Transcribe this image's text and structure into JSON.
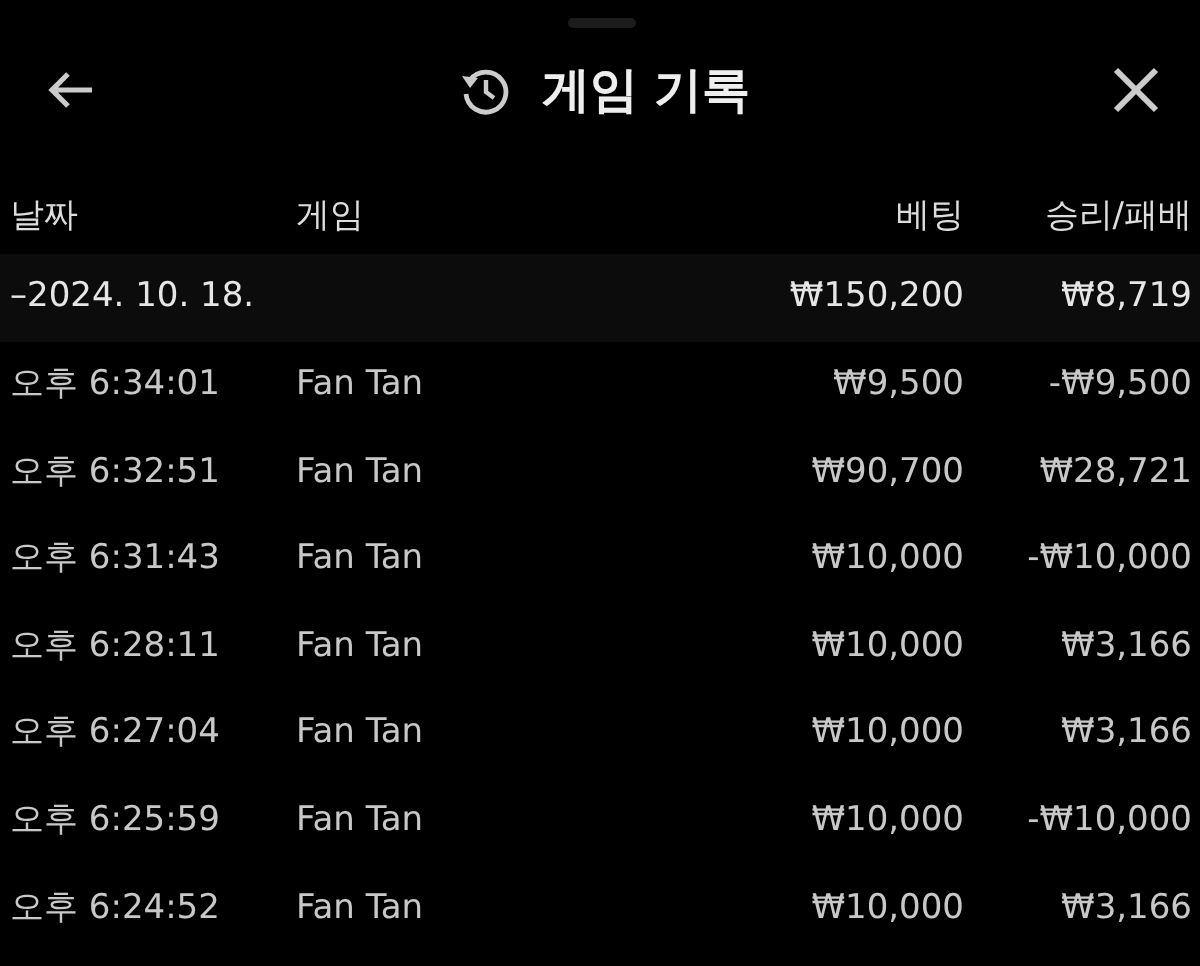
{
  "header": {
    "title": "게임 기록"
  },
  "columns": [
    "날짜",
    "게임",
    "베팅",
    "승리/패배"
  ],
  "group": {
    "date": "–2024. 10. 18.",
    "bet": "₩150,200",
    "result": "₩8,719"
  },
  "rows": [
    {
      "time": "오후 6:34:01",
      "game": "Fan Tan",
      "bet": "₩9,500",
      "result": "-₩9,500"
    },
    {
      "time": "오후 6:32:51",
      "game": "Fan Tan",
      "bet": "₩90,700",
      "result": "₩28,721"
    },
    {
      "time": "오후 6:31:43",
      "game": "Fan Tan",
      "bet": "₩10,000",
      "result": "-₩10,000"
    },
    {
      "time": "오후 6:28:11",
      "game": "Fan Tan",
      "bet": "₩10,000",
      "result": "₩3,166"
    },
    {
      "time": "오후 6:27:04",
      "game": "Fan Tan",
      "bet": "₩10,000",
      "result": "₩3,166"
    },
    {
      "time": "오후 6:25:59",
      "game": "Fan Tan",
      "bet": "₩10,000",
      "result": "-₩10,000"
    },
    {
      "time": "오후 6:24:52",
      "game": "Fan Tan",
      "bet": "₩10,000",
      "result": "₩3,166"
    }
  ]
}
